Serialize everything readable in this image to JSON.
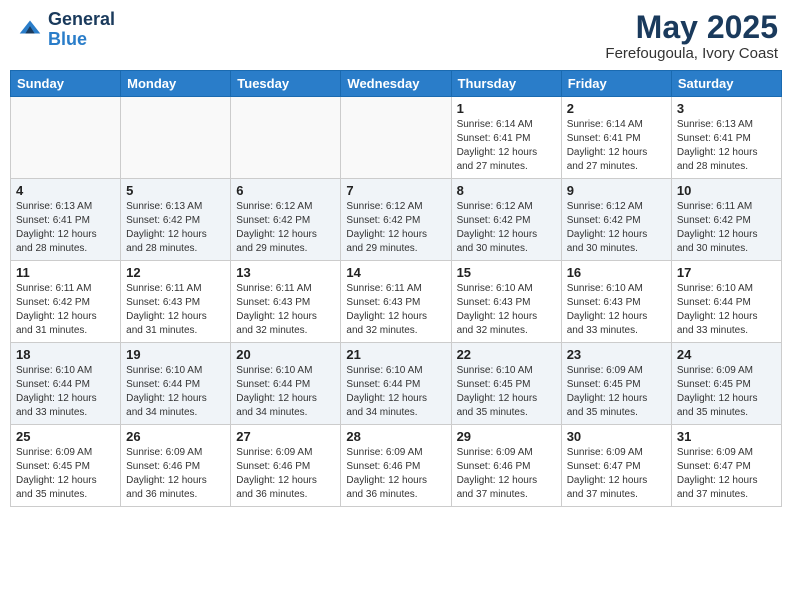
{
  "header": {
    "logo_general": "General",
    "logo_blue": "Blue",
    "month_year": "May 2025",
    "location": "Ferefougoula, Ivory Coast"
  },
  "days_of_week": [
    "Sunday",
    "Monday",
    "Tuesday",
    "Wednesday",
    "Thursday",
    "Friday",
    "Saturday"
  ],
  "weeks": [
    [
      {
        "day": "",
        "info": ""
      },
      {
        "day": "",
        "info": ""
      },
      {
        "day": "",
        "info": ""
      },
      {
        "day": "",
        "info": ""
      },
      {
        "day": "1",
        "info": "Sunrise: 6:14 AM\nSunset: 6:41 PM\nDaylight: 12 hours\nand 27 minutes."
      },
      {
        "day": "2",
        "info": "Sunrise: 6:14 AM\nSunset: 6:41 PM\nDaylight: 12 hours\nand 27 minutes."
      },
      {
        "day": "3",
        "info": "Sunrise: 6:13 AM\nSunset: 6:41 PM\nDaylight: 12 hours\nand 28 minutes."
      }
    ],
    [
      {
        "day": "4",
        "info": "Sunrise: 6:13 AM\nSunset: 6:41 PM\nDaylight: 12 hours\nand 28 minutes."
      },
      {
        "day": "5",
        "info": "Sunrise: 6:13 AM\nSunset: 6:42 PM\nDaylight: 12 hours\nand 28 minutes."
      },
      {
        "day": "6",
        "info": "Sunrise: 6:12 AM\nSunset: 6:42 PM\nDaylight: 12 hours\nand 29 minutes."
      },
      {
        "day": "7",
        "info": "Sunrise: 6:12 AM\nSunset: 6:42 PM\nDaylight: 12 hours\nand 29 minutes."
      },
      {
        "day": "8",
        "info": "Sunrise: 6:12 AM\nSunset: 6:42 PM\nDaylight: 12 hours\nand 30 minutes."
      },
      {
        "day": "9",
        "info": "Sunrise: 6:12 AM\nSunset: 6:42 PM\nDaylight: 12 hours\nand 30 minutes."
      },
      {
        "day": "10",
        "info": "Sunrise: 6:11 AM\nSunset: 6:42 PM\nDaylight: 12 hours\nand 30 minutes."
      }
    ],
    [
      {
        "day": "11",
        "info": "Sunrise: 6:11 AM\nSunset: 6:42 PM\nDaylight: 12 hours\nand 31 minutes."
      },
      {
        "day": "12",
        "info": "Sunrise: 6:11 AM\nSunset: 6:43 PM\nDaylight: 12 hours\nand 31 minutes."
      },
      {
        "day": "13",
        "info": "Sunrise: 6:11 AM\nSunset: 6:43 PM\nDaylight: 12 hours\nand 32 minutes."
      },
      {
        "day": "14",
        "info": "Sunrise: 6:11 AM\nSunset: 6:43 PM\nDaylight: 12 hours\nand 32 minutes."
      },
      {
        "day": "15",
        "info": "Sunrise: 6:10 AM\nSunset: 6:43 PM\nDaylight: 12 hours\nand 32 minutes."
      },
      {
        "day": "16",
        "info": "Sunrise: 6:10 AM\nSunset: 6:43 PM\nDaylight: 12 hours\nand 33 minutes."
      },
      {
        "day": "17",
        "info": "Sunrise: 6:10 AM\nSunset: 6:44 PM\nDaylight: 12 hours\nand 33 minutes."
      }
    ],
    [
      {
        "day": "18",
        "info": "Sunrise: 6:10 AM\nSunset: 6:44 PM\nDaylight: 12 hours\nand 33 minutes."
      },
      {
        "day": "19",
        "info": "Sunrise: 6:10 AM\nSunset: 6:44 PM\nDaylight: 12 hours\nand 34 minutes."
      },
      {
        "day": "20",
        "info": "Sunrise: 6:10 AM\nSunset: 6:44 PM\nDaylight: 12 hours\nand 34 minutes."
      },
      {
        "day": "21",
        "info": "Sunrise: 6:10 AM\nSunset: 6:44 PM\nDaylight: 12 hours\nand 34 minutes."
      },
      {
        "day": "22",
        "info": "Sunrise: 6:10 AM\nSunset: 6:45 PM\nDaylight: 12 hours\nand 35 minutes."
      },
      {
        "day": "23",
        "info": "Sunrise: 6:09 AM\nSunset: 6:45 PM\nDaylight: 12 hours\nand 35 minutes."
      },
      {
        "day": "24",
        "info": "Sunrise: 6:09 AM\nSunset: 6:45 PM\nDaylight: 12 hours\nand 35 minutes."
      }
    ],
    [
      {
        "day": "25",
        "info": "Sunrise: 6:09 AM\nSunset: 6:45 PM\nDaylight: 12 hours\nand 35 minutes."
      },
      {
        "day": "26",
        "info": "Sunrise: 6:09 AM\nSunset: 6:46 PM\nDaylight: 12 hours\nand 36 minutes."
      },
      {
        "day": "27",
        "info": "Sunrise: 6:09 AM\nSunset: 6:46 PM\nDaylight: 12 hours\nand 36 minutes."
      },
      {
        "day": "28",
        "info": "Sunrise: 6:09 AM\nSunset: 6:46 PM\nDaylight: 12 hours\nand 36 minutes."
      },
      {
        "day": "29",
        "info": "Sunrise: 6:09 AM\nSunset: 6:46 PM\nDaylight: 12 hours\nand 37 minutes."
      },
      {
        "day": "30",
        "info": "Sunrise: 6:09 AM\nSunset: 6:47 PM\nDaylight: 12 hours\nand 37 minutes."
      },
      {
        "day": "31",
        "info": "Sunrise: 6:09 AM\nSunset: 6:47 PM\nDaylight: 12 hours\nand 37 minutes."
      }
    ]
  ]
}
